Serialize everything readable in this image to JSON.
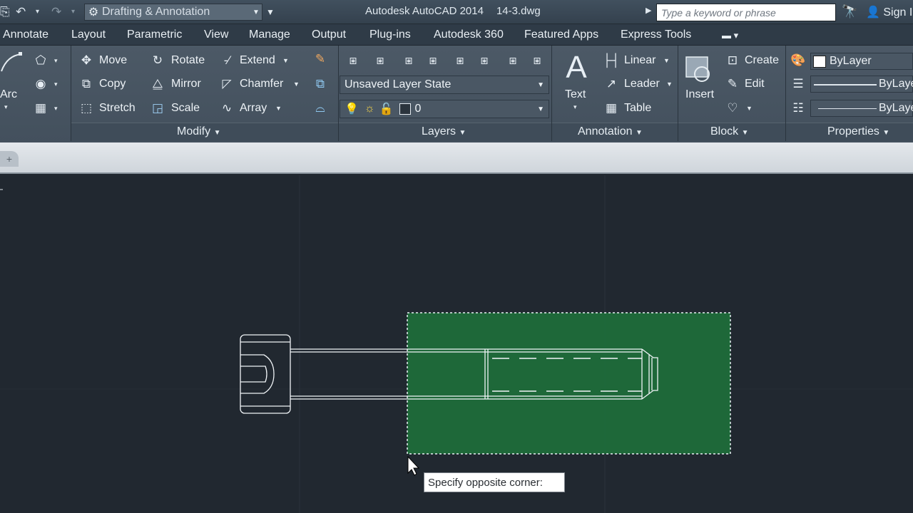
{
  "titlebar": {
    "workspace": "Drafting & Annotation",
    "app_title": "Autodesk AutoCAD 2014",
    "file_name": "14-3.dwg",
    "search_placeholder": "Type a keyword or phrase",
    "sign_in": "Sign In"
  },
  "tabs": [
    "Annotate",
    "Layout",
    "Parametric",
    "View",
    "Manage",
    "Output",
    "Plug-ins",
    "Autodesk 360",
    "Featured Apps",
    "Express Tools"
  ],
  "ribbon": {
    "draw": {
      "arc": "Arc"
    },
    "modify": {
      "move": "Move",
      "rotate": "Rotate",
      "extend": "Extend",
      "copy": "Copy",
      "mirror": "Mirror",
      "chamfer": "Chamfer",
      "stretch": "Stretch",
      "scale": "Scale",
      "array": "Array",
      "title": "Modify"
    },
    "layers": {
      "layer_state": "Unsaved Layer State",
      "current_layer": "0",
      "title": "Layers"
    },
    "annotation": {
      "text": "Text",
      "linear": "Linear",
      "leader": "Leader",
      "table": "Table",
      "title": "Annotation"
    },
    "block": {
      "insert": "Insert",
      "create": "Create",
      "edit": "Edit",
      "title": "Block"
    },
    "properties": {
      "color": "ByLayer",
      "lineweight": "ByLayer",
      "linetype": "ByLayer",
      "title": "Properties"
    }
  },
  "canvas": {
    "tooltip": "Specify opposite corner:",
    "selection_color": "#1f6b3a"
  }
}
